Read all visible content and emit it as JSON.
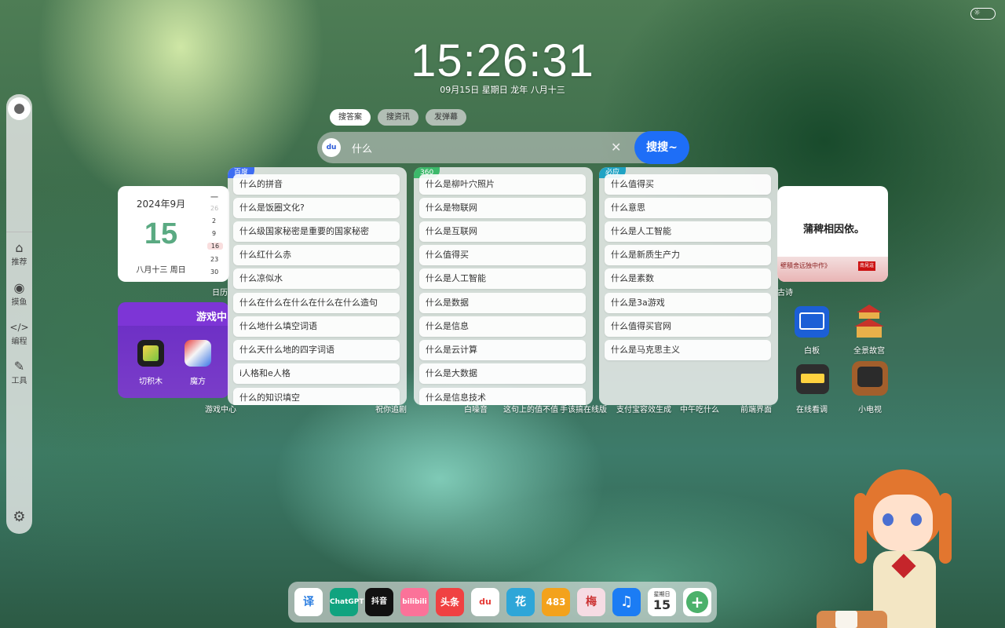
{
  "clock": {
    "time": "15:26:31",
    "date": "09月15日 星期日 龙年 八月十三"
  },
  "search": {
    "tabs": [
      "搜答案",
      "搜资讯",
      "发弹幕"
    ],
    "engine_icon": "du",
    "query": "什么",
    "button": "搜搜~"
  },
  "sidebar": {
    "items": [
      {
        "label": "推荐",
        "icon": "home-icon"
      },
      {
        "label": "摸鱼",
        "icon": "gamepad-icon"
      },
      {
        "label": "编程",
        "icon": "code-icon"
      },
      {
        "label": "工具",
        "icon": "wrench-icon"
      }
    ]
  },
  "calendar": {
    "month": "2024年9月",
    "day": "15",
    "lunar": "八月十三 周日",
    "week_head": "一",
    "week_col": [
      "26",
      "2",
      "9",
      "16",
      "23",
      "30"
    ],
    "label": "日历"
  },
  "game_widget": {
    "title": "游戏中",
    "apps": [
      "切积木",
      "魔方"
    ],
    "label": "游戏中心"
  },
  "suggest": {
    "baidu": {
      "tag": "百度",
      "items": [
        "什么的拼音",
        "什么是饭圈文化?",
        "什么级国家秘密是重要的国家秘密",
        "什么红什么赤",
        "什么凉似水",
        "什么在什么在什么在什么在什么造句",
        "什么地什么填空词语",
        "什么天什么地的四字词语",
        "i人格和e人格",
        "什么的知识填空"
      ]
    },
    "s360": {
      "tag": "360",
      "items": [
        "什么是柳叶穴照片",
        "什么是物联网",
        "什么是互联网",
        "什么值得买",
        "什么是人工智能",
        "什么是数据",
        "什么是信息",
        "什么是云计算",
        "什么是大数据",
        "什么是信息技术"
      ]
    },
    "bing": {
      "tag": "必应",
      "items": [
        "什么值得买",
        "什么意思",
        "什么是人工智能",
        "什么是新质生产力",
        "什么是素数",
        "什么是3a游戏",
        "什么值得买官网",
        "什么是马克思主义"
      ]
    }
  },
  "poem_card": {
    "text": "蒲稗相因依。",
    "sub": "壁積舍远独中作》",
    "seal": "南見這",
    "label": "古诗"
  },
  "apps_right": [
    {
      "label": "白板"
    },
    {
      "label": "全景故宫"
    },
    {
      "label": "在线看调"
    },
    {
      "label": "小电视"
    }
  ],
  "bottom_labels": [
    "祝你追剧",
    "白噪音",
    "这句上的值不值",
    "手该搞在线版",
    "支付宝容效生成",
    "中午吃什么",
    "前端界面"
  ],
  "dock": {
    "apps": [
      "译",
      "ChatGPT",
      "抖音",
      "bilibili",
      "头条",
      "du",
      "花",
      "483",
      "梅",
      "音乐",
      "15",
      "+"
    ],
    "calendar_weekday": "星期日"
  }
}
